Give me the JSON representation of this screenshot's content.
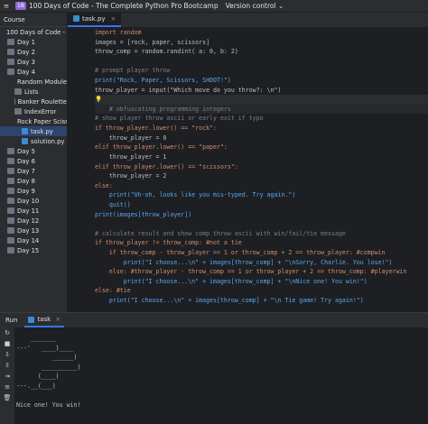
{
  "titlebar": {
    "menu_icon": "≡",
    "project_badge": "1B",
    "project_title": "100 Days of Code - The Complete Python Pro Bootcamp",
    "vcs": "Version control",
    "chevron": "⌄"
  },
  "sidebar": {
    "header": "Course",
    "items": [
      "100 Days of Code - The Com",
      "Day 1",
      "Day 2",
      "Day 3",
      "Day 4",
      "Random Module",
      "Lists",
      "Banker Roulette",
      "IndexError",
      "Rock Paper Scissors",
      "task.py",
      "solution.py",
      "Day 5",
      "Day 6",
      "Day 7",
      "Day 8",
      "Day 9",
      "Day 10",
      "Day 11",
      "Day 12",
      "Day 13",
      "Day 14",
      "Day 15"
    ]
  },
  "editor": {
    "tab_label": "task.py",
    "tab_close": "×",
    "line_numbers": [
      "",
      "",
      "",
      "",
      "",
      "",
      "",
      "",
      "",
      "",
      "",
      "",
      "",
      "",
      "",
      "",
      "",
      "",
      "",
      "",
      "",
      "",
      "",
      "",
      "",
      "",
      "",
      "",
      ""
    ],
    "lines": [
      "import random",
      "images = [rock, paper, scissors]",
      "throw_comp = random.randint( a: 0, b: 2)",
      "",
      "# prompt player throw",
      "print(\"Rock, Paper, Scissors, SHOOT!\")",
      "throw_player = input(\"Which move do you throw?: \\n\")",
      "💡",
      "    # obfuscating programming integers",
      "# show player throw ascii or early exit if typo",
      "if throw_player.lower() == \"rock\":",
      "    throw_player = 0",
      "elif throw_player.lower() == \"paper\":",
      "    throw_player = 1",
      "elif throw_player.lower() == \"scissors\":",
      "    throw_player = 2",
      "else:",
      "    print(\"Uh-oh, looks like you mis-typed. Try again.\")",
      "    quit()",
      "print(images[throw_player])",
      "",
      "# calculate result and show comp throw ascii with win/fail/tie message",
      "if throw_player != throw_comp: #not a tie",
      "    if throw_comp - throw_player == 1 or throw_comp + 2 == throw_player: #compwin",
      "        print(\"I choose...\\n\" + images[throw_comp] + \"\\nSorry, Charlie. You lose!\")",
      "    else: #throw_player - throw_comp == 1 or throw_player + 2 == throw_comp: #playerwin",
      "        print(\"I choose...\\n\" + images[throw_comp] + \"\\nNice one! You win!\")",
      "else: #tie",
      "    print(\"I choose...\\n\" + images[throw_comp] + \"\\n Tie game! Try again!\")"
    ]
  },
  "run": {
    "label": "Run",
    "tab": "task",
    "tab_close": "×",
    "tools": [
      "↻",
      "■",
      "⇩",
      "⇳",
      "⇥",
      "≡",
      "🗑"
    ],
    "console_lines": [
      "    _______",
      "---'   ____)____",
      "          ______)",
      "       __________)",
      "      (____)",
      "---.__(___)",
      "",
      "Nice one! You win!"
    ]
  }
}
